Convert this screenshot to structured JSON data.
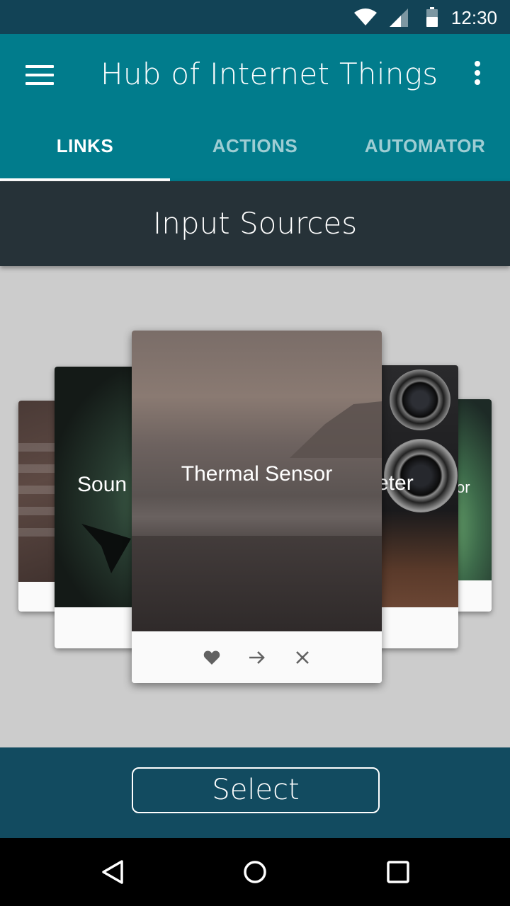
{
  "status_bar": {
    "time": "12:30",
    "icons": [
      "wifi-icon",
      "signal-icon",
      "battery-icon"
    ]
  },
  "app_bar": {
    "title": "Hub of Internet Things",
    "menu_icon": "menu-icon",
    "overflow_icon": "more-vert-icon"
  },
  "tabs": [
    {
      "label": "LINKS",
      "active": true
    },
    {
      "label": "ACTIONS",
      "active": false
    },
    {
      "label": "AUTOMATOR",
      "active": false
    }
  ],
  "section": {
    "title": "Input Sources"
  },
  "carousel": {
    "cards": [
      {
        "label": "",
        "position": "far-left"
      },
      {
        "label": "Sound",
        "position": "left"
      },
      {
        "label": "Thermal Sensor",
        "position": "center"
      },
      {
        "label": "Meter",
        "position": "right"
      },
      {
        "label": "Sensor",
        "position": "far-right"
      }
    ],
    "center_actions": [
      "heart-icon",
      "arrow-right-icon",
      "close-icon"
    ]
  },
  "bottom": {
    "select_label": "Select"
  },
  "nav_bar": {
    "icons": [
      "back-icon",
      "home-icon",
      "recents-icon"
    ]
  },
  "colors": {
    "status_bar": "#124356",
    "app_bar": "#017c8c",
    "section_header": "#263238",
    "bottom_bar": "#124b60",
    "background": "#cccccc"
  }
}
